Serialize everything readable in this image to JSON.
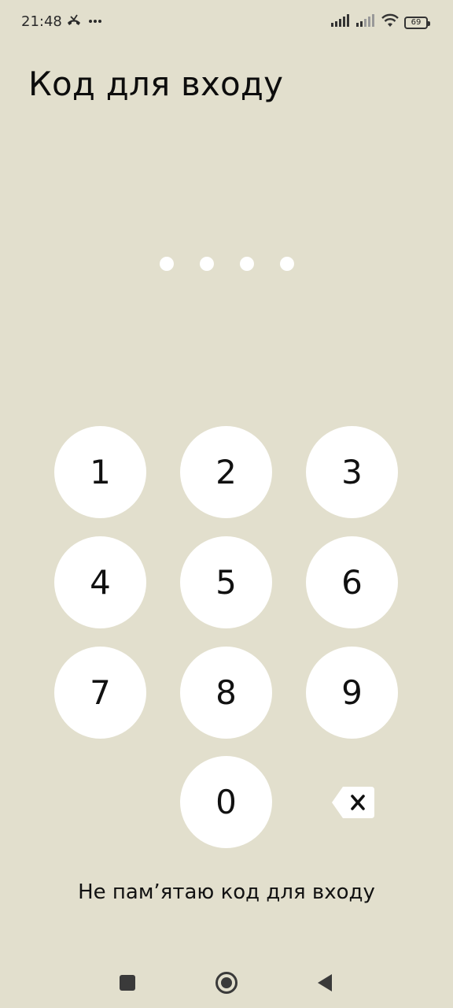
{
  "status_bar": {
    "time": "21:48",
    "battery_level": "69",
    "icons": [
      "missed-call-icon",
      "more-dots-icon",
      "signal-icon",
      "signal-icon",
      "wifi-icon",
      "battery-icon"
    ]
  },
  "page": {
    "title": "Код для входу"
  },
  "pin": {
    "length": 4,
    "filled": 0,
    "dot_color": "#ffffff"
  },
  "keypad": {
    "keys": [
      "1",
      "2",
      "3",
      "4",
      "5",
      "6",
      "7",
      "8",
      "9",
      "0"
    ],
    "backspace_icon": "backspace-icon"
  },
  "forgot_link": {
    "label": "Не пам’ятаю код для входу"
  },
  "navigation": {
    "icons": [
      "recent-apps-icon",
      "home-icon",
      "back-icon"
    ]
  },
  "colors": {
    "background": "#e2dfcd",
    "key_background": "#ffffff",
    "text": "#111111"
  }
}
